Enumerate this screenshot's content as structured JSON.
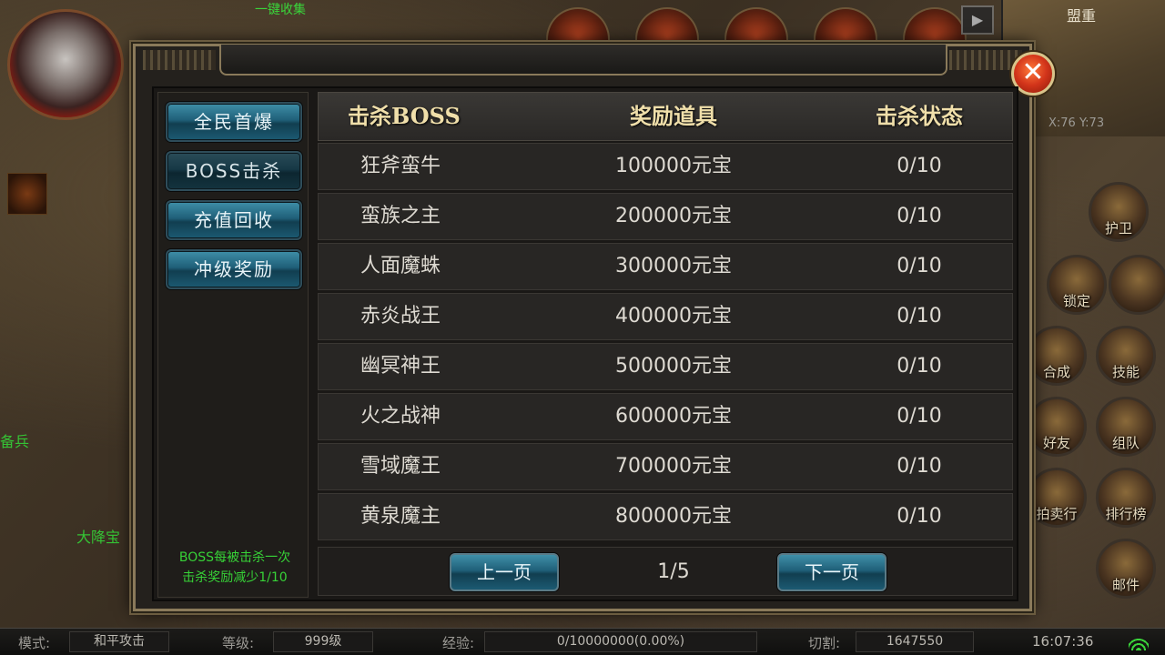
{
  "hud": {
    "top_text": "一键收集",
    "minimap_title": "盟重",
    "minimap_coord": "X:76 Y:73",
    "left_text_1": "备兵",
    "left_text_2": "大降宝",
    "side_buttons": [
      "护卫",
      "锁定",
      "合成",
      "技能",
      "好友",
      "组队",
      "拍卖行",
      "排行榜",
      "邮件"
    ]
  },
  "status_bar": {
    "mode_label": "模式:",
    "mode_value": "和平攻击",
    "level_label": "等级:",
    "level_value": "999级",
    "exp_label": "经验:",
    "exp_value": "0/10000000(0.00%)",
    "cut_label": "切割:",
    "cut_value": "1647550",
    "time": "16:07:36"
  },
  "dialog": {
    "close_glyph": "✕",
    "tabs": [
      {
        "label": "全民首爆"
      },
      {
        "label": "BOSS击杀"
      },
      {
        "label": "充值回收"
      },
      {
        "label": "冲级奖励"
      }
    ],
    "note_line1": "BOSS每被击杀一次",
    "note_line2": "击杀奖励减少1/10",
    "headers": {
      "boss": "击杀BOSS",
      "reward": "奖励道具",
      "status": "击杀状态"
    },
    "rows": [
      {
        "boss": "狂斧蛮牛",
        "reward": "100000元宝",
        "status": "0/10"
      },
      {
        "boss": "蛮族之主",
        "reward": "200000元宝",
        "status": "0/10"
      },
      {
        "boss": "人面魔蛛",
        "reward": "300000元宝",
        "status": "0/10"
      },
      {
        "boss": "赤炎战王",
        "reward": "400000元宝",
        "status": "0/10"
      },
      {
        "boss": "幽冥神王",
        "reward": "500000元宝",
        "status": "0/10"
      },
      {
        "boss": "火之战神",
        "reward": "600000元宝",
        "status": "0/10"
      },
      {
        "boss": "雪域魔王",
        "reward": "700000元宝",
        "status": "0/10"
      },
      {
        "boss": "黄泉魔主",
        "reward": "800000元宝",
        "status": "0/10"
      }
    ],
    "pager": {
      "prev_label": "上一页",
      "next_label": "下一页",
      "page_text": "1/5"
    }
  }
}
